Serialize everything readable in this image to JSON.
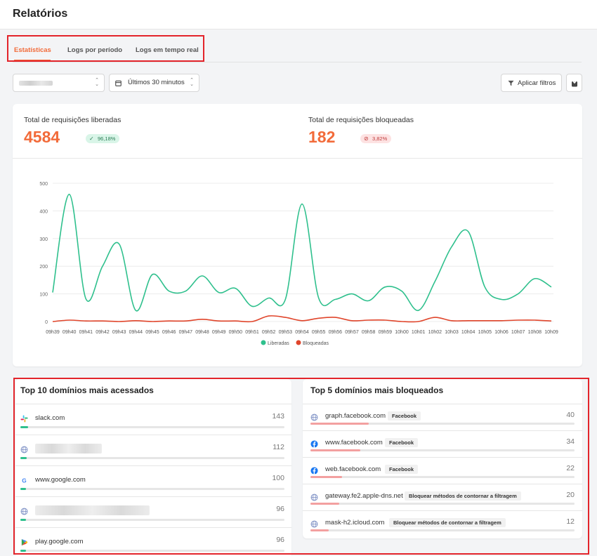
{
  "header": {
    "title": "Relatórios"
  },
  "tabs": [
    {
      "label": "Estatísticas",
      "active": true
    },
    {
      "label": "Logs por período",
      "active": false
    },
    {
      "label": "Logs em tempo real",
      "active": false
    }
  ],
  "filters": {
    "period": "Últimos 30 minutos",
    "apply_label": "Aplicar filtros"
  },
  "stats": {
    "allowed": {
      "label": "Total de requisições liberadas",
      "value": "4584",
      "pct": "96,18%"
    },
    "blocked": {
      "label": "Total de requisições bloqueadas",
      "value": "182",
      "pct": "3,82%"
    }
  },
  "colors": {
    "accent": "#f26b3a",
    "allowed": "#2fc08d",
    "blocked": "#e0452b"
  },
  "chart_data": {
    "type": "line",
    "x": [
      "09h39",
      "09h40",
      "09h41",
      "09h42",
      "09h43",
      "09h44",
      "09h45",
      "09h46",
      "09h47",
      "09h48",
      "09h49",
      "09h50",
      "09h51",
      "09h52",
      "09h53",
      "09h54",
      "09h55",
      "09h56",
      "09h57",
      "09h58",
      "09h59",
      "10h00",
      "10h01",
      "10h02",
      "10h03",
      "10h04",
      "10h05",
      "10h06",
      "10h07",
      "10h08",
      "10h09"
    ],
    "yticks": [
      0,
      100,
      200,
      300,
      400,
      500
    ],
    "ylim": [
      0,
      500
    ],
    "series": [
      {
        "name": "Liberadas",
        "color": "#2fc08d",
        "values": [
          105,
          460,
          82,
          200,
          280,
          40,
          170,
          110,
          110,
          165,
          105,
          120,
          55,
          85,
          80,
          425,
          85,
          80,
          100,
          75,
          125,
          110,
          40,
          145,
          270,
          325,
          125,
          80,
          100,
          155,
          125
        ]
      },
      {
        "name": "Bloqueadas",
        "color": "#e0452b",
        "values": [
          0,
          5,
          2,
          2,
          0,
          3,
          0,
          2,
          2,
          8,
          2,
          2,
          0,
          20,
          15,
          3,
          12,
          15,
          3,
          5,
          5,
          0,
          0,
          15,
          3,
          3,
          3,
          3,
          5,
          5,
          2
        ]
      }
    ],
    "legend": [
      "Liberadas",
      "Bloqueadas"
    ],
    "legend_position": "bottom",
    "grid": true
  },
  "top_accessed": {
    "title": "Top 10 domínios mais acessados",
    "items": [
      {
        "name": "slack.com",
        "count": "143",
        "icon": "slack-icon",
        "fraction": 0.03
      },
      {
        "name": "",
        "count": "112",
        "icon": "globe-icon",
        "fraction": 0.024
      },
      {
        "name": "www.google.com",
        "count": "100",
        "icon": "google-icon",
        "fraction": 0.022
      },
      {
        "name": "",
        "count": "96",
        "icon": "globe-icon",
        "fraction": 0.021
      },
      {
        "name": "play.google.com",
        "count": "96",
        "icon": "google-play-icon",
        "fraction": 0.021
      }
    ]
  },
  "top_blocked": {
    "title": "Top 5 domínios mais bloqueados",
    "items": [
      {
        "name": "graph.facebook.com",
        "tag": "Facebook",
        "count": "40",
        "icon": "globe-icon",
        "fraction": 0.22
      },
      {
        "name": "www.facebook.com",
        "tag": "Facebook",
        "count": "34",
        "icon": "facebook-icon",
        "fraction": 0.19
      },
      {
        "name": "web.facebook.com",
        "tag": "Facebook",
        "count": "22",
        "icon": "facebook-icon",
        "fraction": 0.12
      },
      {
        "name": "gateway.fe2.apple-dns.net",
        "tag": "Bloquear métodos de contornar a filtragem",
        "count": "20",
        "icon": "globe-icon",
        "fraction": 0.11
      },
      {
        "name": "mask-h2.icloud.com",
        "tag": "Bloquear métodos de contornar a filtragem",
        "count": "12",
        "icon": "globe-icon",
        "fraction": 0.07
      }
    ]
  }
}
